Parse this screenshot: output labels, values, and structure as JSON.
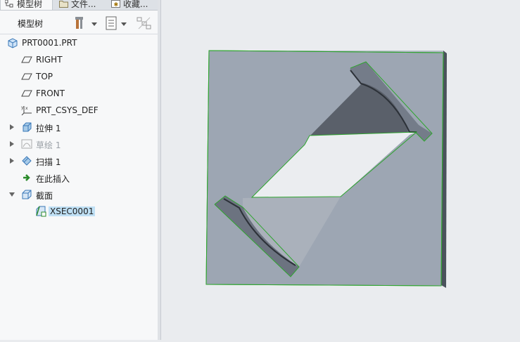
{
  "tabs": [
    {
      "label": "模型树",
      "icon": "model-tree-icon",
      "active": true
    },
    {
      "label": "文件...",
      "icon": "folder-icon",
      "active": false
    },
    {
      "label": "收藏...",
      "icon": "favorites-icon",
      "active": false
    }
  ],
  "toolbar": {
    "title": "模型树",
    "settings_icon": "tree-settings-icon",
    "columns_icon": "show-columns-icon",
    "filter_icon": "filter-icon"
  },
  "tree": {
    "root": {
      "label": "PRT0001.PRT",
      "icon": "part-icon"
    },
    "items": [
      {
        "label": "RIGHT",
        "icon": "datum-plane-icon",
        "expandable": false
      },
      {
        "label": "TOP",
        "icon": "datum-plane-icon",
        "expandable": false
      },
      {
        "label": "FRONT",
        "icon": "datum-plane-icon",
        "expandable": false
      },
      {
        "label": "PRT_CSYS_DEF",
        "icon": "coordinate-system-icon",
        "expandable": false
      },
      {
        "label": "拉伸 1",
        "icon": "extrude-icon",
        "expandable": true
      },
      {
        "label": "草绘 1",
        "icon": "sketch-icon",
        "expandable": true,
        "suppressed": true
      },
      {
        "label": "扫描 1",
        "icon": "sweep-icon",
        "expandable": true
      },
      {
        "label": "在此插入",
        "icon": "insert-here-arrow-icon",
        "expandable": false
      },
      {
        "label": "截面",
        "icon": "section-folder-icon",
        "expandable": true,
        "expanded": true
      },
      {
        "label": "XSEC0001",
        "icon": "cross-section-icon",
        "selected": true
      }
    ]
  },
  "colors": {
    "panel_bg": "#f7f8f9",
    "viewport_bg": "#eaecef",
    "model_face": "#9da6b3",
    "model_edge_highlight": "#2fa52f",
    "selection": "#bfe0f5"
  }
}
